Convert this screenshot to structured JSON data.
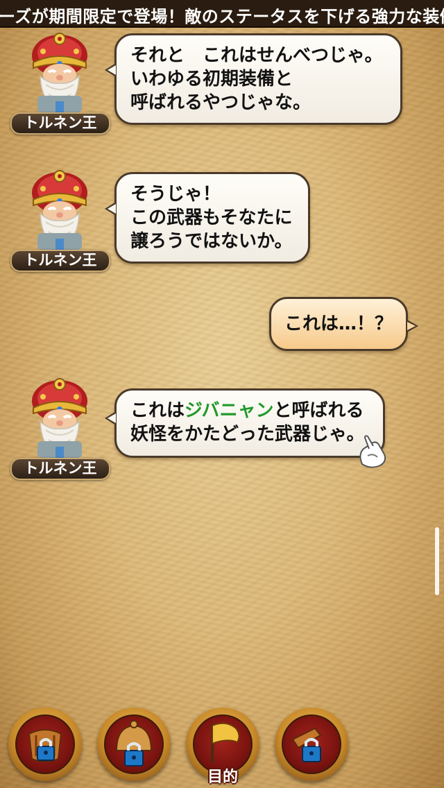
{
  "ticker": {
    "text": "ーズが期間限定で登場！敵のステータスを下げる強力な装備"
  },
  "messages": [
    {
      "speaker": "トルネン王",
      "lines": [
        "それと　これはせんべつじゃ。",
        "いわゆる初期装備と",
        "呼ばれるやつじゃな。"
      ]
    },
    {
      "speaker": "トルネン王",
      "lines": [
        "そうじゃ！",
        "この武器もそなたに",
        "譲ろうではないか。"
      ]
    },
    {
      "player_line": "これは…！？"
    },
    {
      "speaker": "トルネン王",
      "line1_pre": "これは",
      "line1_highlight": "ジバニャン",
      "line1_post": "と呼ばれる",
      "line2": "妖怪をかたどった武器じゃ。"
    }
  ],
  "bottom_menu": {
    "items": [
      {
        "icon": "locked-armor-icon",
        "label": ""
      },
      {
        "icon": "locked-helmet-icon",
        "label": ""
      },
      {
        "icon": "objective-flag-icon",
        "label": "目的"
      },
      {
        "icon": "locked-item-icon",
        "label": ""
      }
    ]
  },
  "colors": {
    "highlight": "#1f9a2a",
    "bubble_player": "#f6c98a",
    "parchment": "#dcb97a"
  }
}
